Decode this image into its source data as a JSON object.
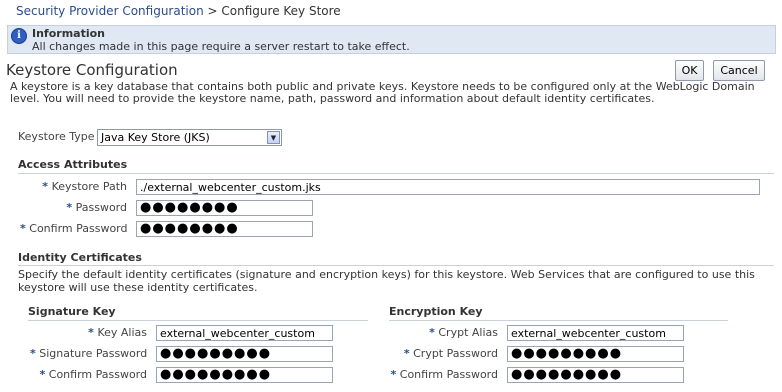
{
  "breadcrumb": {
    "parent": "Security Provider Configuration",
    "separator": ">",
    "current": "Configure Key Store"
  },
  "info": {
    "icon": "info-icon",
    "title": "Information",
    "message": "All changes made in this page require a server restart to take effect."
  },
  "page": {
    "title": "Keystore Configuration",
    "ok_label": "OK",
    "cancel_label": "Cancel",
    "description": "A keystore is a key database that contains both public and private keys. Keystore needs to be configured only at the WebLogic Domain level. You will need to provide the keystore name, path, password and information about default identity certificates."
  },
  "keystore_type": {
    "label": "Keystore Type",
    "value": "Java Key Store (JKS)"
  },
  "access": {
    "heading": "Access Attributes",
    "required_mark": "*",
    "path_label": "Keystore Path",
    "path_value": "./external_webcenter_custom.jks",
    "password_label": "Password",
    "password_value": "●●●●●●●●",
    "confirm_label": "Confirm Password",
    "confirm_value": "●●●●●●●●"
  },
  "identity": {
    "heading": "Identity Certificates",
    "description": "Specify the default identity certificates (signature and encryption keys) for this keystore. Web Services that are configured to use this keystore will use these identity certificates."
  },
  "signature": {
    "heading": "Signature Key",
    "alias_label": "Key Alias",
    "alias_value": "external_webcenter_custom",
    "password_label": "Signature Password",
    "password_value": "●●●●●●●●●",
    "confirm_label": "Confirm Password",
    "confirm_value": "●●●●●●●●●"
  },
  "encryption": {
    "heading": "Encryption Key",
    "alias_label": "Crypt Alias",
    "alias_value": "external_webcenter_custom",
    "password_label": "Crypt Password",
    "password_value": "●●●●●●●●●",
    "confirm_label": "Confirm Password",
    "confirm_value": "●●●●●●●●●"
  }
}
